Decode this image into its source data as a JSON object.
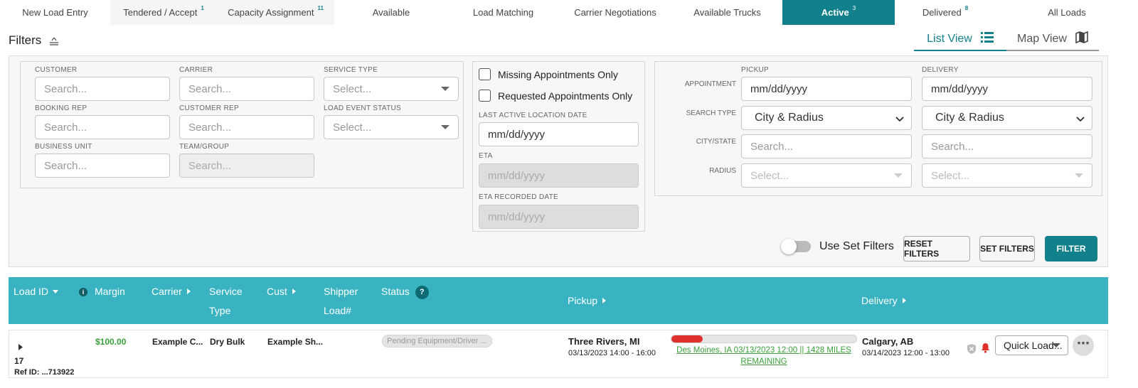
{
  "tabs": [
    {
      "label": "New Load Entry",
      "badge": ""
    },
    {
      "label": "Tendered / Accept",
      "badge": "1"
    },
    {
      "label": "Capacity Assignment",
      "badge": "11"
    },
    {
      "label": "Available",
      "badge": ""
    },
    {
      "label": "Load Matching",
      "badge": ""
    },
    {
      "label": "Carrier Negotiations",
      "badge": ""
    },
    {
      "label": "Available Trucks",
      "badge": ""
    },
    {
      "label": "Active",
      "badge": "3"
    },
    {
      "label": "Delivered",
      "badge": "8"
    },
    {
      "label": "All Loads",
      "badge": ""
    }
  ],
  "filters": {
    "title": "Filters",
    "list_view": "List View",
    "map_view": "Map View",
    "customer": {
      "label": "CUSTOMER",
      "placeholder": "Search..."
    },
    "carrier": {
      "label": "CARRIER",
      "placeholder": "Search..."
    },
    "service_type": {
      "label": "SERVICE TYPE",
      "placeholder": "Select..."
    },
    "booking_rep": {
      "label": "BOOKING REP",
      "placeholder": "Search..."
    },
    "customer_rep": {
      "label": "CUSTOMER REP",
      "placeholder": "Search..."
    },
    "load_event_status": {
      "label": "LOAD EVENT STATUS",
      "placeholder": "Select..."
    },
    "business_unit": {
      "label": "BUSINESS UNIT",
      "placeholder": "Search..."
    },
    "team_group": {
      "label": "TEAM/GROUP",
      "placeholder": "Search..."
    },
    "missing_appts": "Missing Appointments Only",
    "requested_appts": "Requested Appointments Only",
    "last_active_location_date": {
      "label": "LAST ACTIVE LOCATION DATE",
      "placeholder": "mm/dd/yyyy"
    },
    "eta": {
      "label": "ETA",
      "placeholder": "mm/dd/yyyy"
    },
    "eta_recorded_date": {
      "label": "ETA RECORDED DATE",
      "placeholder": "mm/dd/yyyy"
    },
    "pickup_header": "PICKUP",
    "delivery_header": "DELIVERY",
    "appointment_label": "APPOINTMENT",
    "search_type_label": "SEARCH TYPE",
    "city_state_label": "CITY/STATE",
    "radius_label": "RADIUS",
    "date_placeholder": "mm/dd/yyyy",
    "search_type_value": "City & Radius",
    "search_placeholder": "Search...",
    "select_placeholder": "Select...",
    "use_set_filters": "Use Set Filters",
    "reset_filters": "RESET FILTERS",
    "set_filters": "SET FILTERS",
    "filter": "FILTER"
  },
  "table": {
    "headers": {
      "load_id": "Load ID",
      "margin": "Margin",
      "carrier": "Carrier",
      "service_type_1": "Service",
      "service_type_2": "Type",
      "cust": "Cust",
      "shipper_1": "Shipper",
      "shipper_2": "Load#",
      "status": "Status",
      "status_help": "?",
      "pickup": "Pickup",
      "delivery": "Delivery"
    },
    "rows": [
      {
        "load_id": "17",
        "ref_id": "Ref ID: ...713922",
        "margin": "$100.00",
        "carrier": "Example C...",
        "service_type": "Dry Bulk",
        "cust": "Example Sh...",
        "status": "Pending Equipment/Driver ...",
        "pickup_city": "Three Rivers, MI",
        "pickup_time": "03/13/2023 14:00 - 16:00",
        "progress": 0.17,
        "route_line1": "Des Moines, IA 03/13/2023 12:00 || 1428 MILES",
        "route_line2": "REMAINING",
        "delivery_city": "Calgary, AB",
        "delivery_time": "03/14/2023 12:00 - 13:00",
        "quick_load": "Quick Load...",
        "more": "⋯"
      }
    ]
  },
  "colors": {
    "accent": "#12818c",
    "header_bg": "#39b3c1",
    "margin_green": "#3aa03a",
    "progress_red": "#e0312c"
  }
}
